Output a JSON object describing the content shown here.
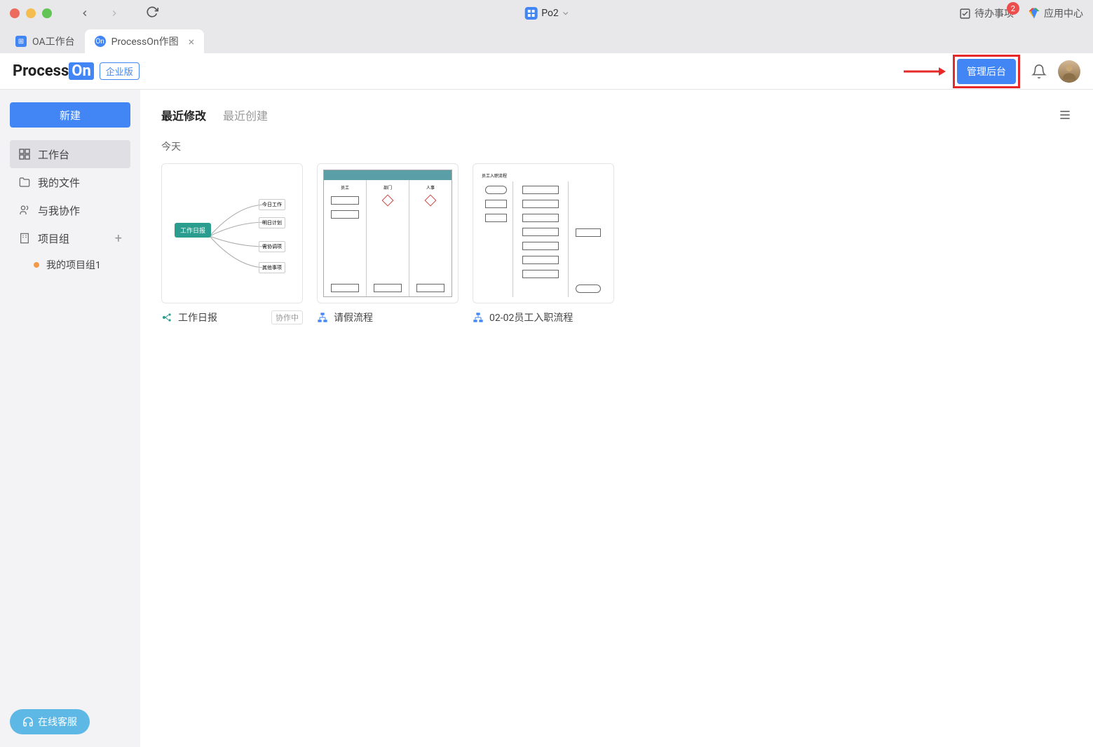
{
  "titlebar": {
    "title": "Po2",
    "todo_label": "待办事项",
    "todo_count": "2",
    "appcenter_label": "应用中心"
  },
  "tabs": [
    {
      "label": "OA工作台",
      "active": false
    },
    {
      "label": "ProcessOn作图",
      "active": true
    }
  ],
  "header": {
    "logo_1": "Process",
    "logo_2": "On",
    "badge": "企业版",
    "admin_btn": "管理后台"
  },
  "sidebar": {
    "new_btn": "新建",
    "items": [
      {
        "icon": "dashboard-icon",
        "label": "工作台",
        "active": true
      },
      {
        "icon": "folder-icon",
        "label": "我的文件"
      },
      {
        "icon": "people-icon",
        "label": "与我协作"
      },
      {
        "icon": "building-icon",
        "label": "项目组",
        "has_plus": true
      }
    ],
    "sub_item": "我的项目组1",
    "support_btn": "在线客服"
  },
  "content": {
    "tabs": [
      {
        "label": "最近修改",
        "active": true
      },
      {
        "label": "最近创建",
        "active": false
      }
    ],
    "section": "今天",
    "cards": [
      {
        "type": "mindmap",
        "title": "工作日报",
        "badge": "协作中",
        "type_color": "#2a9d8f"
      },
      {
        "type": "flowchart",
        "title": "请假流程",
        "type_color": "#4285f4"
      },
      {
        "type": "flowchart",
        "title": "02-02员工入职流程",
        "type_color": "#4285f4"
      }
    ]
  },
  "colors": {
    "primary": "#4285f4",
    "highlight": "#e62828"
  }
}
